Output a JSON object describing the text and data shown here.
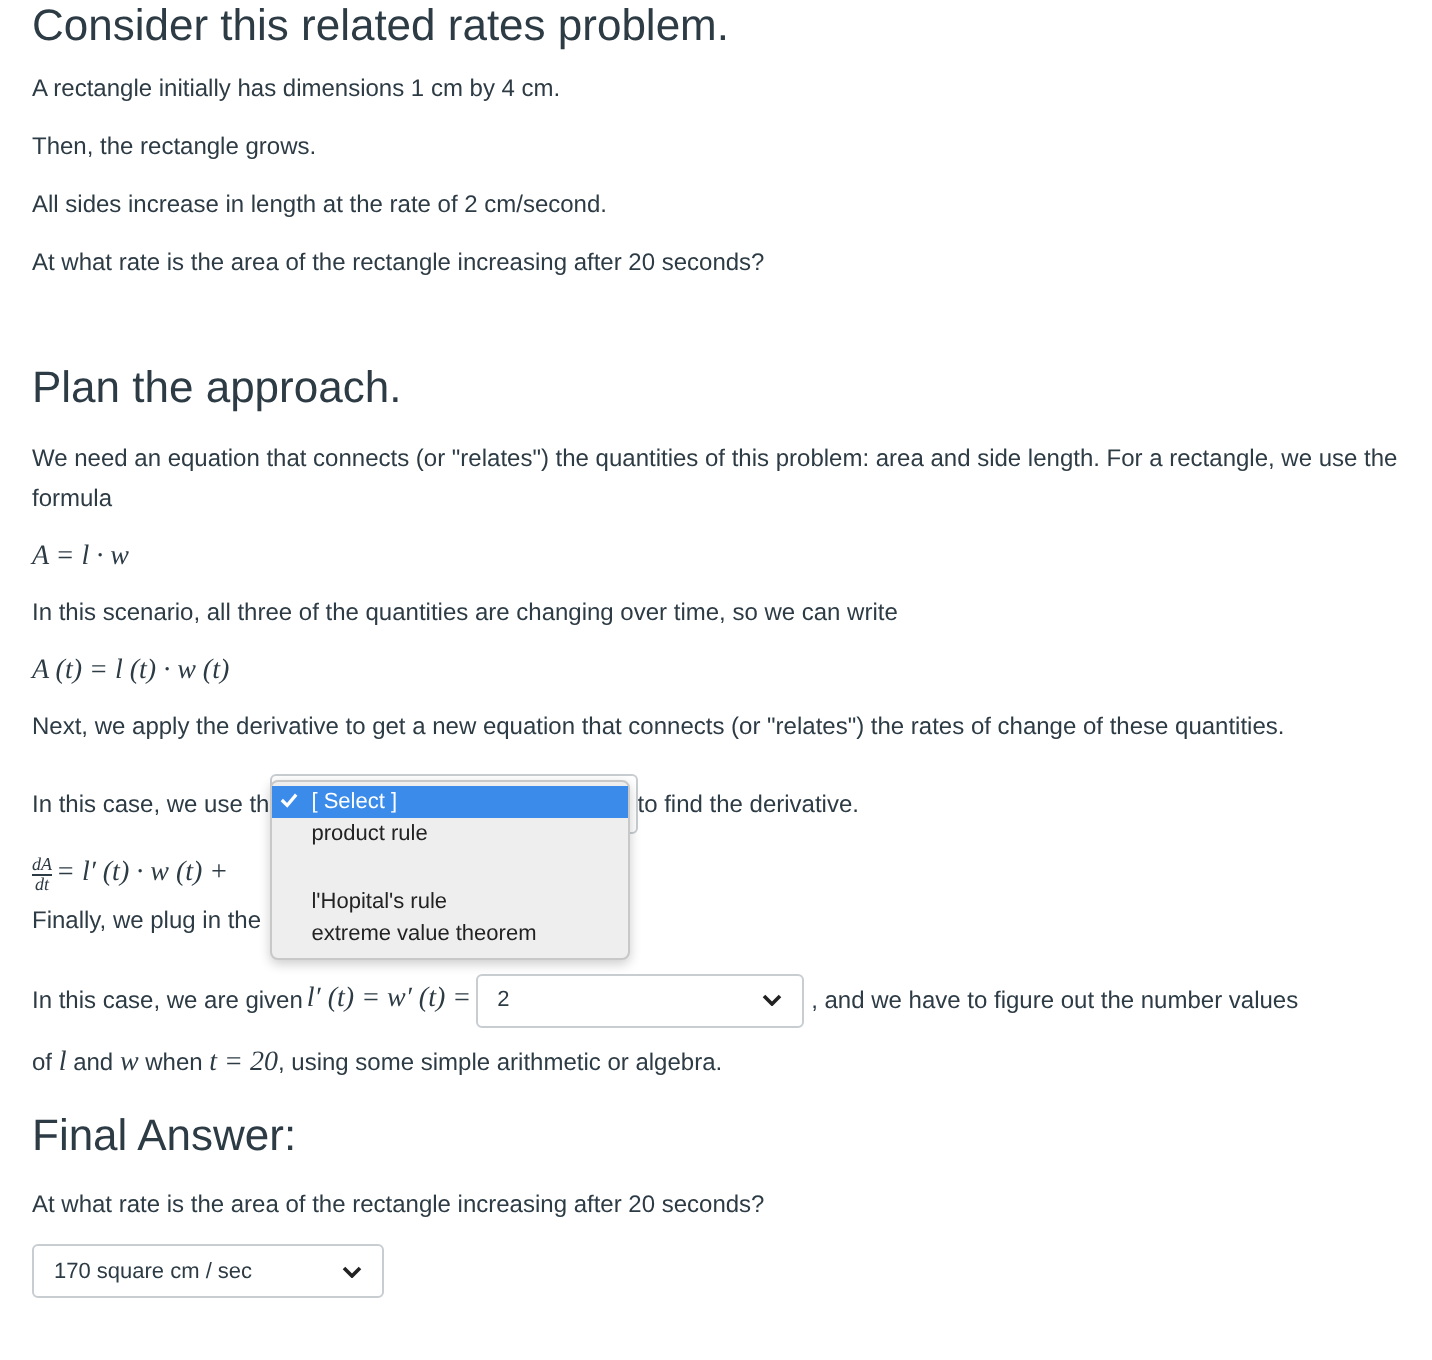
{
  "problem": {
    "heading": "Consider this related rates problem.",
    "lines": [
      "A rectangle initially has dimensions 1 cm by 4 cm.",
      "Then, the rectangle grows.",
      "All sides increase in length at the rate of 2 cm/second.",
      "At what rate is the area of the rectangle increasing after 20 seconds?"
    ]
  },
  "approach": {
    "heading": "Plan the approach.",
    "intro": "We need an equation that connects (or \"relates\") the quantities of this problem: area and side length. For a rectangle, we use the formula",
    "formula_1": "A = l · w",
    "scenario": "In this scenario, all three of the quantities are changing over time, so we can write",
    "formula_2": "A (t) = l (t) · w (t)",
    "next": "Next, we apply the derivative to get a new equation that connects (or \"relates\") the rates of change of these quantities.",
    "rule_before": "In this case, we use th",
    "rule_after": "to find the derivative.",
    "rule_menu": [
      {
        "label": "[ Select ]",
        "selected": true,
        "separated": false
      },
      {
        "label": "product rule",
        "selected": false,
        "separated": false
      },
      {
        "label": "l'Hopital's rule",
        "selected": false,
        "separated": true
      },
      {
        "label": "extreme value theorem",
        "selected": false,
        "separated": false
      }
    ],
    "derivative_num": "dA",
    "derivative_den": "dt",
    "derivative_rhs": "= l′ (t) · w (t) +",
    "plug_in": "Finally, we plug in the",
    "given_before": "In this case, we are given",
    "given_math": "l′ (t) = w′ (t) =",
    "given_value": "2",
    "given_after": ", and we have to figure out the number values",
    "last_line": [
      {
        "text": "of ",
        "math": false
      },
      {
        "text": "l",
        "math": true
      },
      {
        "text": " and ",
        "math": false
      },
      {
        "text": "w",
        "math": true
      },
      {
        "text": " when ",
        "math": false
      },
      {
        "text": "t = 20",
        "math": true
      },
      {
        "text": ", using some simple arithmetic or algebra.",
        "math": false
      }
    ]
  },
  "final": {
    "heading": "Final Answer:",
    "question": "At what rate is the area of the rectangle increasing after 20 seconds?",
    "answer": "170 square cm / sec"
  }
}
